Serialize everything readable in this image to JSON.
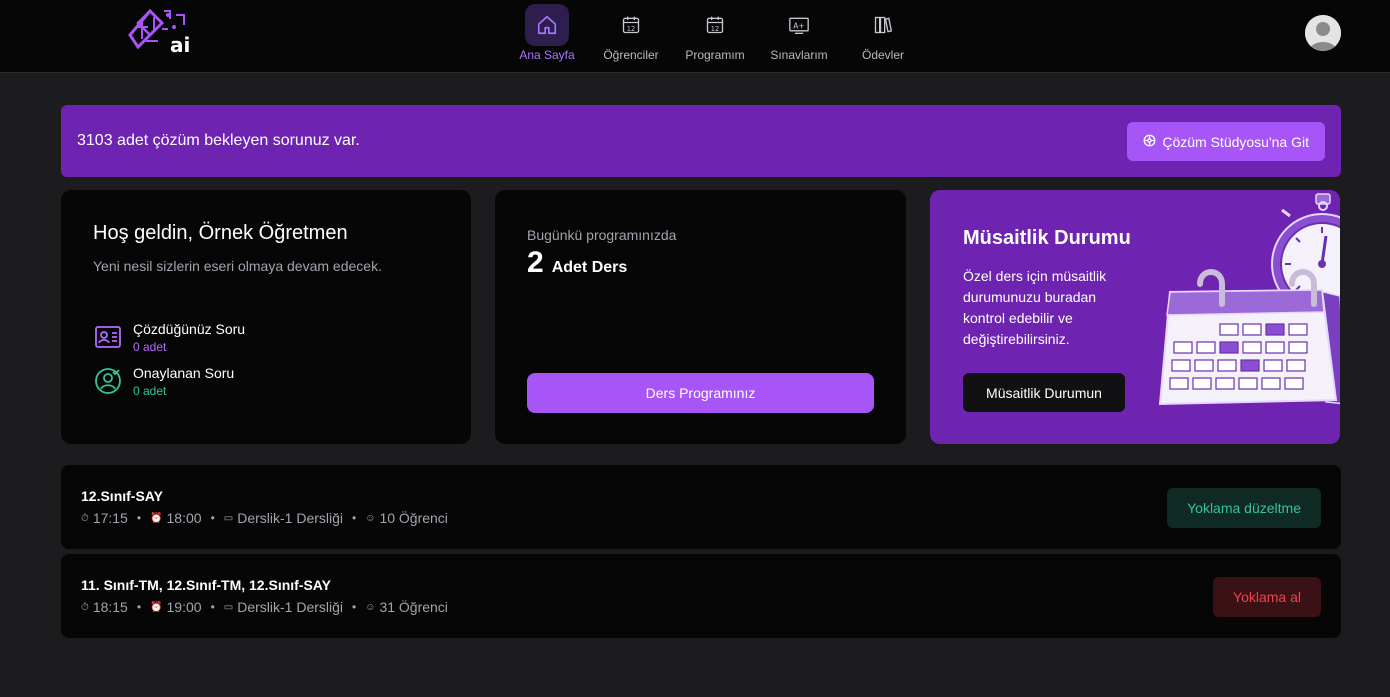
{
  "header": {
    "nav": [
      {
        "label": "Ana Sayfa",
        "icon": "home-icon",
        "active": true
      },
      {
        "label": "Öğrenciler",
        "icon": "calendar-12-icon"
      },
      {
        "label": "Programım",
        "icon": "calendar-12-icon"
      },
      {
        "label": "Sınavlarım",
        "icon": "grade-board-icon"
      },
      {
        "label": "Ödevler",
        "icon": "books-icon"
      }
    ]
  },
  "banner": {
    "text": "3103 adet çözüm bekleyen sorunuz var.",
    "button_label": "Çözüm Stüdyosu'na Git"
  },
  "welcome": {
    "title": "Hoş geldin, Örnek Öğretmen",
    "subtitle": "Yeni nesil sizlerin eseri olmaya devam edecek.",
    "stats": [
      {
        "label": "Çözdüğünüz Soru",
        "value": "0 adet",
        "color": "#b46bff"
      },
      {
        "label": "Onaylanan Soru",
        "value": "0 adet",
        "color": "#33c49a"
      }
    ]
  },
  "program": {
    "subtitle": "Bugünkü programınızda",
    "count": "2",
    "unit": "Adet Ders",
    "button_label": "Ders Programınız"
  },
  "availability": {
    "title": "Müsaitlik Durumu",
    "description": "Özel ders için müsaitlik durumunuzu buradan kontrol edebilir ve değiştirebilirsiniz.",
    "button_label": "Müsaitlik Durumun"
  },
  "classes": [
    {
      "title": "12.Sınıf-SAY",
      "start": "17:15",
      "end": "18:00",
      "room": "Derslik-1 Dersliği",
      "students": "10 Öğrenci",
      "action": "Yoklama düzeltme"
    },
    {
      "title": "11. Sınıf-TM, 12.Sınıf-TM, 12.Sınıf-SAY",
      "start": "18:15",
      "end": "19:00",
      "room": "Derslik-1 Dersliği",
      "students": "31 Öğrenci",
      "action": "Yoklama al"
    }
  ],
  "colors": {
    "accent": "#a855f7",
    "banner": "#6e23b1",
    "success": "#33c49a",
    "danger": "#f0424c"
  }
}
